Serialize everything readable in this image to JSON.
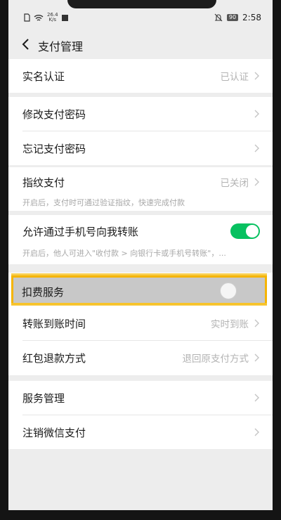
{
  "status_bar": {
    "speed_value": "26.4",
    "speed_unit": "K/s",
    "battery": "90",
    "time": "2:58"
  },
  "header": {
    "title": "支付管理"
  },
  "groups": [
    {
      "rows": [
        {
          "label": "实名认证",
          "value": "已认证"
        }
      ]
    },
    {
      "rows": [
        {
          "label": "修改支付密码",
          "value": ""
        },
        {
          "label": "忘记支付密码",
          "value": ""
        }
      ]
    },
    {
      "rows": [
        {
          "label": "指纹支付",
          "value": "已关闭"
        }
      ],
      "description": "开启后，支付时可通过验证指纹，快速完成付款"
    },
    {
      "rows": [
        {
          "label": "允许通过手机号向我转账",
          "toggle": true
        }
      ],
      "description": "开启后，他人可进入\"收付款 > 向银行卡或手机号转账\"，..."
    },
    {
      "rows": [
        {
          "label": "扣费服务",
          "toggle": false
        },
        {
          "label": "转账到账时间",
          "value": "实时到账"
        },
        {
          "label": "红包退款方式",
          "value": "退回原支付方式"
        }
      ]
    },
    {
      "rows": [
        {
          "label": "服务管理",
          "value": ""
        },
        {
          "label": "注销微信支付",
          "value": ""
        }
      ]
    }
  ],
  "colors": {
    "accent": "#07c160",
    "highlight_border": "#f5b400",
    "background": "#ededed"
  }
}
